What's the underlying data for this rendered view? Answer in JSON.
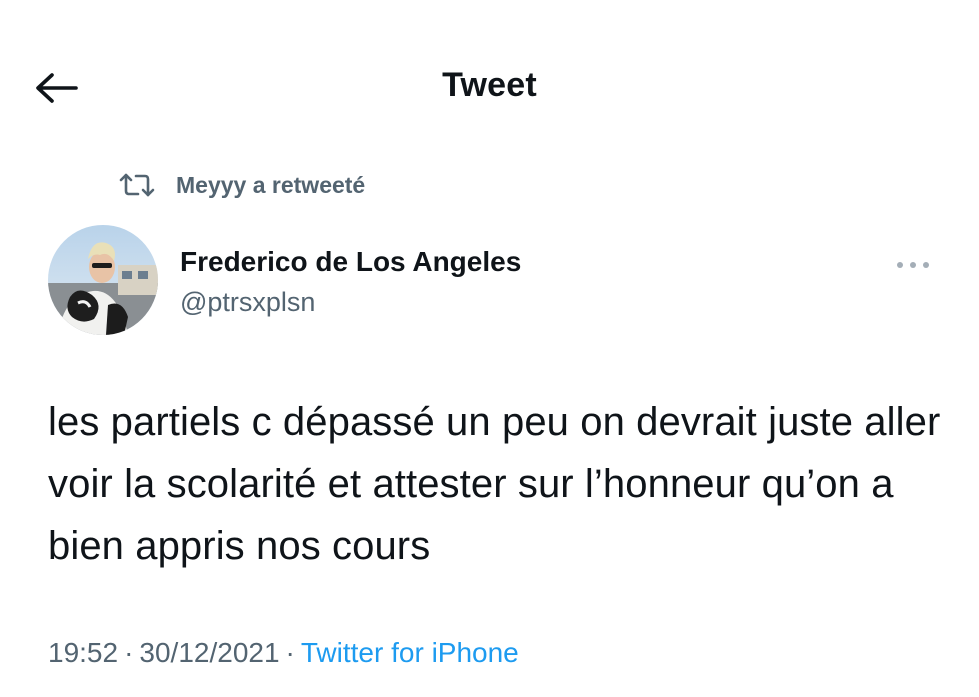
{
  "header": {
    "title": "Tweet",
    "back_icon": "arrow-left-icon"
  },
  "retweet": {
    "icon": "retweet-icon",
    "text": "Meyyy a retweeté"
  },
  "author": {
    "display_name": "Frederico de Los Angeles",
    "handle": "@ptrsxplsn"
  },
  "tweet": {
    "text": "les partiels c dépassé un peu on devrait juste aller voir la scolarité et attester sur l’honneur qu’on a bien appris nos cours"
  },
  "meta": {
    "time": "19:52",
    "separator": "·",
    "date": "30/12/2021",
    "source": "Twitter for iPhone"
  },
  "colors": {
    "text_primary": "#0f1419",
    "text_secondary": "#536471",
    "link": "#1d9bf0"
  }
}
